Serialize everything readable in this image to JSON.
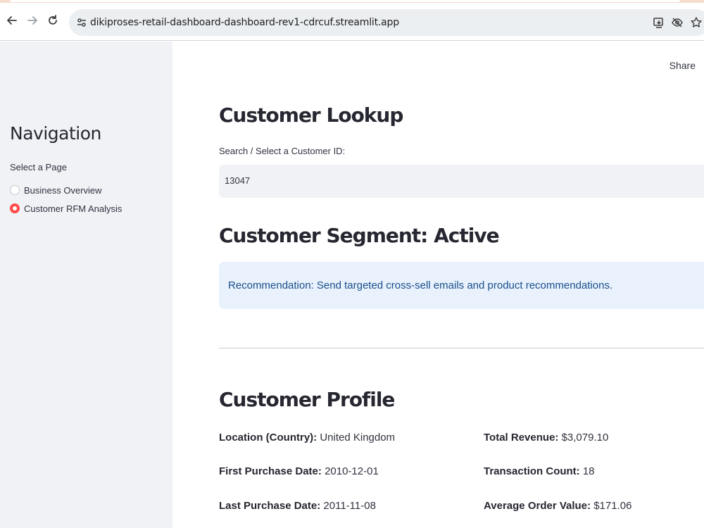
{
  "browser": {
    "url": "dikiproses-retail-dashboard-dashboard-rev1-cdrcuf.streamlit.app"
  },
  "sidebar": {
    "title": "Navigation",
    "radio_label": "Select a Page",
    "options": [
      {
        "label": "Business Overview",
        "selected": false
      },
      {
        "label": "Customer RFM Analysis",
        "selected": true
      }
    ]
  },
  "header": {
    "share_label": "Share"
  },
  "lookup": {
    "title": "Customer Lookup",
    "select_label": "Search / Select a Customer ID:",
    "selected_value": "13047"
  },
  "segment": {
    "title": "Customer Segment: Active",
    "recommendation": "Recommendation: Send targeted cross-sell emails and product recommendations."
  },
  "profile": {
    "title": "Customer Profile",
    "left": [
      {
        "label": "Location (Country):",
        "value": "United Kingdom"
      },
      {
        "label": "First Purchase Date:",
        "value": "2010-12-01"
      },
      {
        "label": "Last Purchase Date:",
        "value": "2011-11-08"
      }
    ],
    "right": [
      {
        "label": "Total Revenue:",
        "value": "$3,079.10"
      },
      {
        "label": "Transaction Count:",
        "value": "18"
      },
      {
        "label": "Average Order Value:",
        "value": "$171.06"
      }
    ]
  },
  "colors": {
    "accent": "#ff4b4b",
    "sidebar_bg": "#f0f2f6",
    "info_bg": "#e8f1fc",
    "info_text": "#1a4f8b"
  }
}
